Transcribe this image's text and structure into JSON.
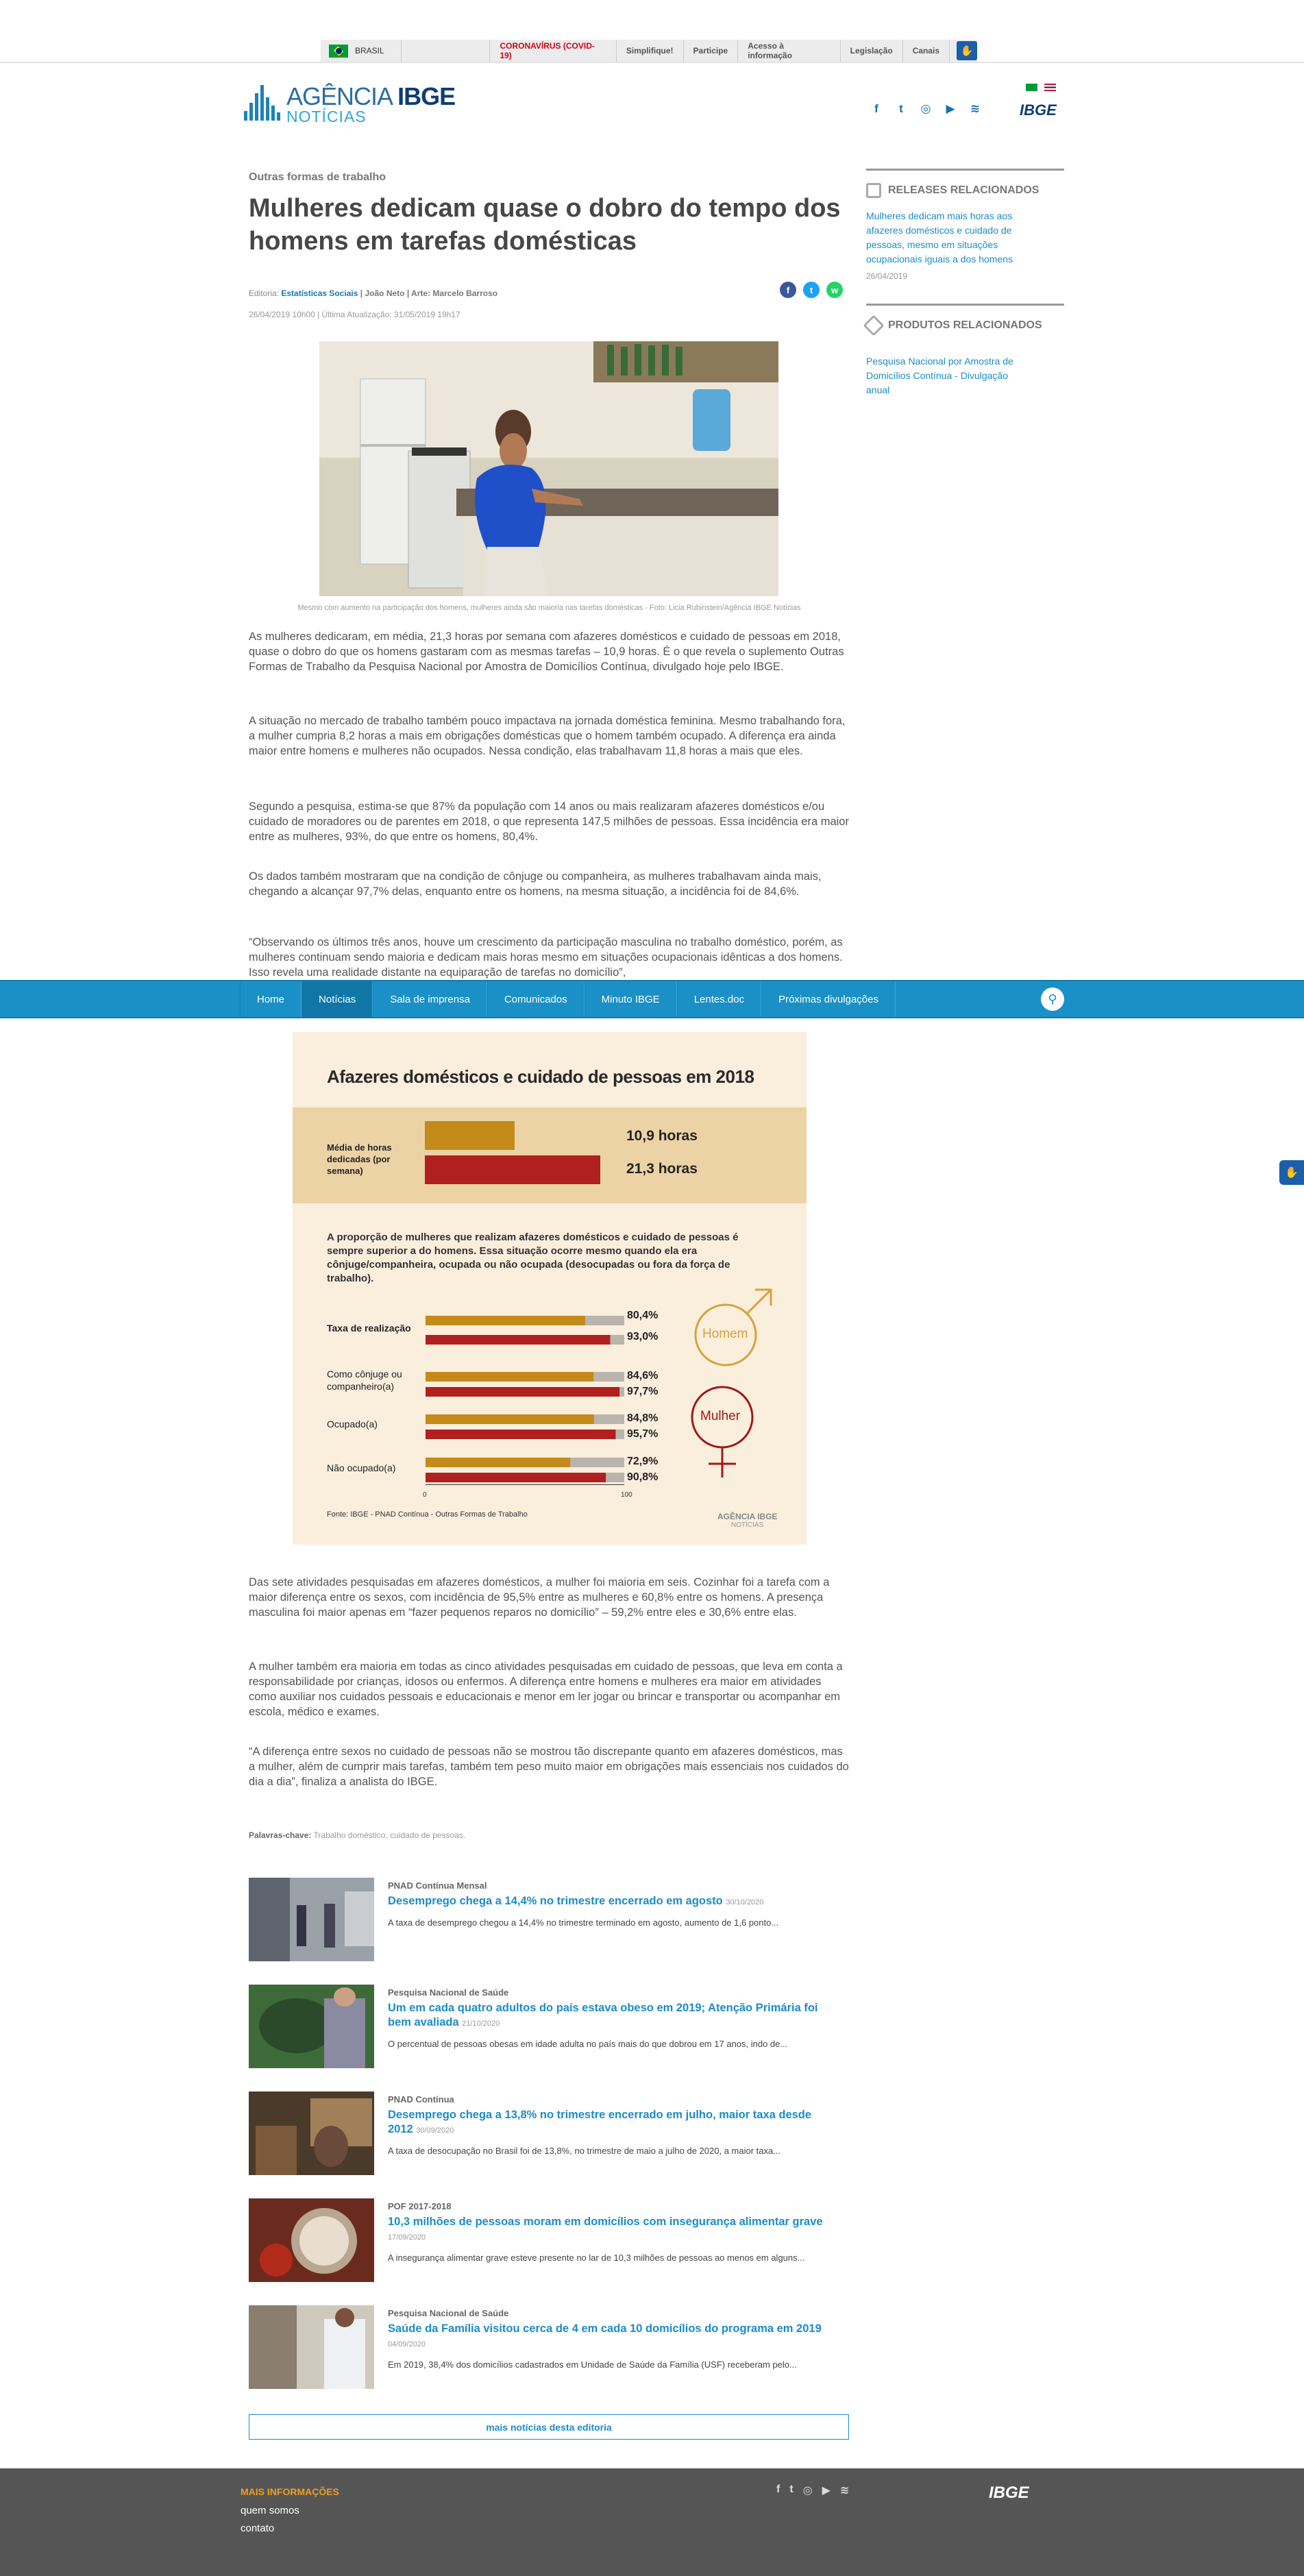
{
  "govbar": {
    "country": "BRASIL",
    "links": [
      "CORONAVÍRUS (COVID-19)",
      "Simplifique!",
      "Participe",
      "Acesso à informação",
      "Legislação",
      "Canais"
    ]
  },
  "logo": {
    "agencia": "AGÊNCIA",
    "ibge": "IBGE",
    "noticias": "NOTÍCIAS"
  },
  "header": {
    "ibge_logo": "IBGE",
    "social_icons": [
      "facebook-icon",
      "twitter-icon",
      "instagram-icon",
      "youtube-icon",
      "rss-icon"
    ]
  },
  "article": {
    "kicker": "Outras formas de trabalho",
    "title": "Mulheres dedicam quase o dobro do tempo dos homens em tarefas domésticas",
    "editoria_label": "Editoria:",
    "editoria": "Estatísticas Sociais",
    "author": "| João Neto | Arte: Marcelo Barroso",
    "dates": "26/04/2019 10h00 | Última Atualização: 31/05/2019 19h17",
    "caption": "Mesmo com aumento na participação dos homens, mulheres ainda são maioria nas tarefas domésticas - Foto: Licia Rubinstein/Agência IBGE Notícias",
    "paragraphs": [
      "As mulheres dedicaram, em média, 21,3 horas por semana com afazeres domésticos e cuidado de pessoas em 2018, quase o dobro do que os homens gastaram com as mesmas tarefas – 10,9 horas. É o que revela o suplemento Outras Formas de Trabalho da Pesquisa Nacional por Amostra de Domicílios Contínua, divulgado hoje pelo IBGE.",
      "A situação no mercado de trabalho também pouco impactava na jornada doméstica feminina. Mesmo trabalhando fora, a mulher cumpria 8,2 horas a mais em obrigações domésticas que o homem também ocupado. A diferença era ainda maior entre homens e mulheres não ocupados. Nessa condição, elas trabalhavam 11,8 horas a mais que eles.",
      "Segundo a pesquisa, estima-se que 87% da população com 14 anos ou mais realizaram afazeres domésticos e/ou cuidado de moradores ou de parentes em 2018, o que representa 147,5 milhões de pessoas. Essa incidência era maior entre as mulheres, 93%, do que entre os homens, 80,4%.",
      "Os dados também mostraram que na condição de cônjuge ou companheira, as mulheres trabalhavam ainda mais, chegando a alcançar 97,7% delas, enquanto entre os homens, na mesma situação, a incidência foi de 84,6%.",
      "“Observando os últimos três anos, houve um crescimento da participação masculina no trabalho doméstico, porém, as mulheres continuam sendo maioria e dedicam mais horas mesmo em situações ocupacionais idênticas a dos homens. Isso revela uma realidade distante na equiparação de tarefas no domicílio”,",
      "Das sete atividades pesquisadas em afazeres domésticos, a mulher foi maioria em seis. Cozinhar foi a tarefa com a maior diferença entre os sexos, com incidência de 95,5% entre as mulheres e 60,8% entre os homens. A presença masculina foi maior apenas em “fazer pequenos reparos no domicílio” – 59,2% entre eles e 30,6% entre elas.",
      "A mulher também era maioria em todas as cinco atividades pesquisadas em cuidado de pessoas, que leva em conta a responsabilidade por crianças, idosos ou enfermos. A diferença entre homens e mulheres era maior em atividades como auxiliar nos cuidados pessoais e educacionais e menor em ler jogar ou brincar e transportar ou acompanhar em escola, médico e exames.",
      "“A diferença entre sexos no cuidado de pessoas não se mostrou tão discrepante quanto em afazeres domésticos, mas a mulher, além de cumprir mais tarefas, também tem peso muito maior em obrigações mais essenciais nos cuidados do dia a dia”, finaliza a analista do IBGE."
    ],
    "tags_label": "Palavras-chave:",
    "tags": "Trabalho doméstico, cuidado de pessoas."
  },
  "nav": {
    "items": [
      "Home",
      "Notícias",
      "Sala de imprensa",
      "Comunicados",
      "Minuto IBGE",
      "Lentes.doc",
      "Próximas divulgações"
    ],
    "active": "Notícias"
  },
  "sidebar": {
    "releases_title": "RELEASES RELACIONADOS",
    "release_link": "Mulheres dedicam mais horas aos afazeres domésticos e cuidado de pessoas, mesmo em situações ocupacionais iguais a dos homens",
    "release_date": "26/04/2019",
    "products_title": "PRODUTOS RELACIONADOS",
    "product_link": "Pesquisa Nacional por Amostra de Domicílios Contínua - Divulgação anual"
  },
  "infographic": {
    "title": "Afazeres domésticos e cuidado de pessoas em 2018",
    "hours_label": "Média de horas dedicadas (por semana)",
    "hours_men": "10,9 horas",
    "hours_women": "21,3 horas",
    "description": "A proporção de mulheres que realizam afazeres domésticos e cuidado de pessoas é sempre superior a do homens. Essa situação ocorre mesmo quando ela era cônjuge/companheira, ocupada ou não ocupada (desocupadas ou fora da força de trabalho).",
    "rows": [
      {
        "label": "Taxa de realização",
        "men": "80,4%",
        "women": "93,0%"
      },
      {
        "label": "Como cônjuge ou companheiro(a)",
        "men": "84,6%",
        "women": "97,7%"
      },
      {
        "label": "Ocupado(a)",
        "men": "84,8%",
        "women": "95,7%"
      },
      {
        "label": "Não ocupado(a)",
        "men": "72,9%",
        "women": "90,8%"
      }
    ],
    "homem": "Homem",
    "mulher": "Mulher",
    "axis_min": "0",
    "axis_max": "100",
    "source": "Fonte: IBGE - PNAD Contínua - Outras Formas de Trabalho",
    "brand": "AGÊNCIA IBGE",
    "brand_sub": "NOTÍCIAS",
    "colors": {
      "men": "#c48a1a",
      "women": "#b0201e",
      "rest": "#b9b5ad"
    }
  },
  "chart_data": {
    "type": "bar",
    "title": "Afazeres domésticos e cuidado de pessoas em 2018",
    "categories": [
      "Taxa de realização",
      "Como cônjuge ou companheiro(a)",
      "Ocupado(a)",
      "Não ocupado(a)"
    ],
    "series": [
      {
        "name": "Homem",
        "values": [
          80.4,
          84.6,
          84.8,
          72.9
        ]
      },
      {
        "name": "Mulher",
        "values": [
          93.0,
          97.7,
          95.7,
          90.8
        ]
      }
    ],
    "hours": {
      "categories": [
        "Homem",
        "Mulher"
      ],
      "values": [
        10.9,
        21.3
      ]
    },
    "xlim": [
      0,
      100
    ]
  },
  "related": [
    {
      "cat": "PNAD Contínua Mensal",
      "title": "Desemprego chega a 14,4% no trimestre encerrado em agosto",
      "date": "30/10/2020",
      "snippet": "A taxa de desemprego chegou a 14,4% no trimestre terminado em agosto, aumento de 1,6 ponto..."
    },
    {
      "cat": "Pesquisa Nacional de Saúde",
      "title": "Um em cada quatro adultos do país estava obeso em 2019; Atenção Primária foi bem avaliada",
      "date": "21/10/2020",
      "snippet": "O percentual de pessoas obesas em idade adulta no país mais do que dobrou em 17 anos, indo de..."
    },
    {
      "cat": "PNAD Contínua",
      "title": "Desemprego chega a 13,8% no trimestre encerrado em julho, maior taxa desde 2012",
      "date": "30/09/2020",
      "snippet": "A taxa de desocupação no Brasil foi de 13,8%, no trimestre de maio a julho de 2020, a maior taxa..."
    },
    {
      "cat": "POF 2017-2018",
      "title": "10,3 milhões de pessoas moram em domicílios com insegurança alimentar grave",
      "date": "17/09/2020",
      "snippet": "A insegurança alimentar grave esteve presente no lar de 10,3 milhões de pessoas ao menos em alguns..."
    },
    {
      "cat": "Pesquisa Nacional de Saúde",
      "title": "Saúde da Família visitou cerca de 4 em cada 10 domicílios do programa em 2019",
      "date": "04/09/2020",
      "snippet": "Em 2019, 38,4% dos domicílios cadastrados em Unidade de Saúde da Família (USF) receberam pelo..."
    }
  ],
  "more_button": "mais notícias desta editoria",
  "footer": {
    "title": "MAIS INFORMAÇÕES",
    "links": [
      "quem somos",
      "contato"
    ],
    "ibge": "IBGE"
  }
}
